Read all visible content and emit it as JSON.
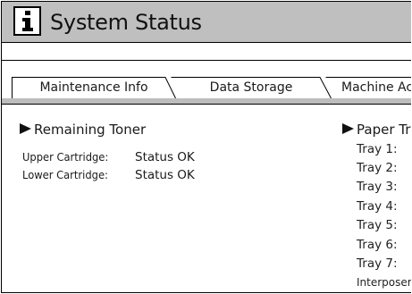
{
  "header": {
    "icon": "info-icon",
    "title": "System Status"
  },
  "tabs": [
    {
      "label": "Maintenance Info",
      "selected": true
    },
    {
      "label": "Data Storage",
      "selected": false
    },
    {
      "label": "Machine Ac",
      "selected": false
    }
  ],
  "toner": {
    "heading": "Remaining Toner",
    "rows": [
      {
        "label": "Upper Cartridge:",
        "value": "Status OK"
      },
      {
        "label": "Lower Cartridge:",
        "value": "Status OK"
      }
    ]
  },
  "paper": {
    "heading": "Paper Tray",
    "rows": [
      "Tray 1:",
      "Tray 2:",
      "Tray 3:",
      "Tray 4:",
      "Tray 5:",
      "Tray 6:",
      "Tray 7:",
      "Interposer Up"
    ]
  },
  "colors": {
    "header_bg": "#bfbfbf",
    "tab_strip": "#bdbdbd"
  }
}
